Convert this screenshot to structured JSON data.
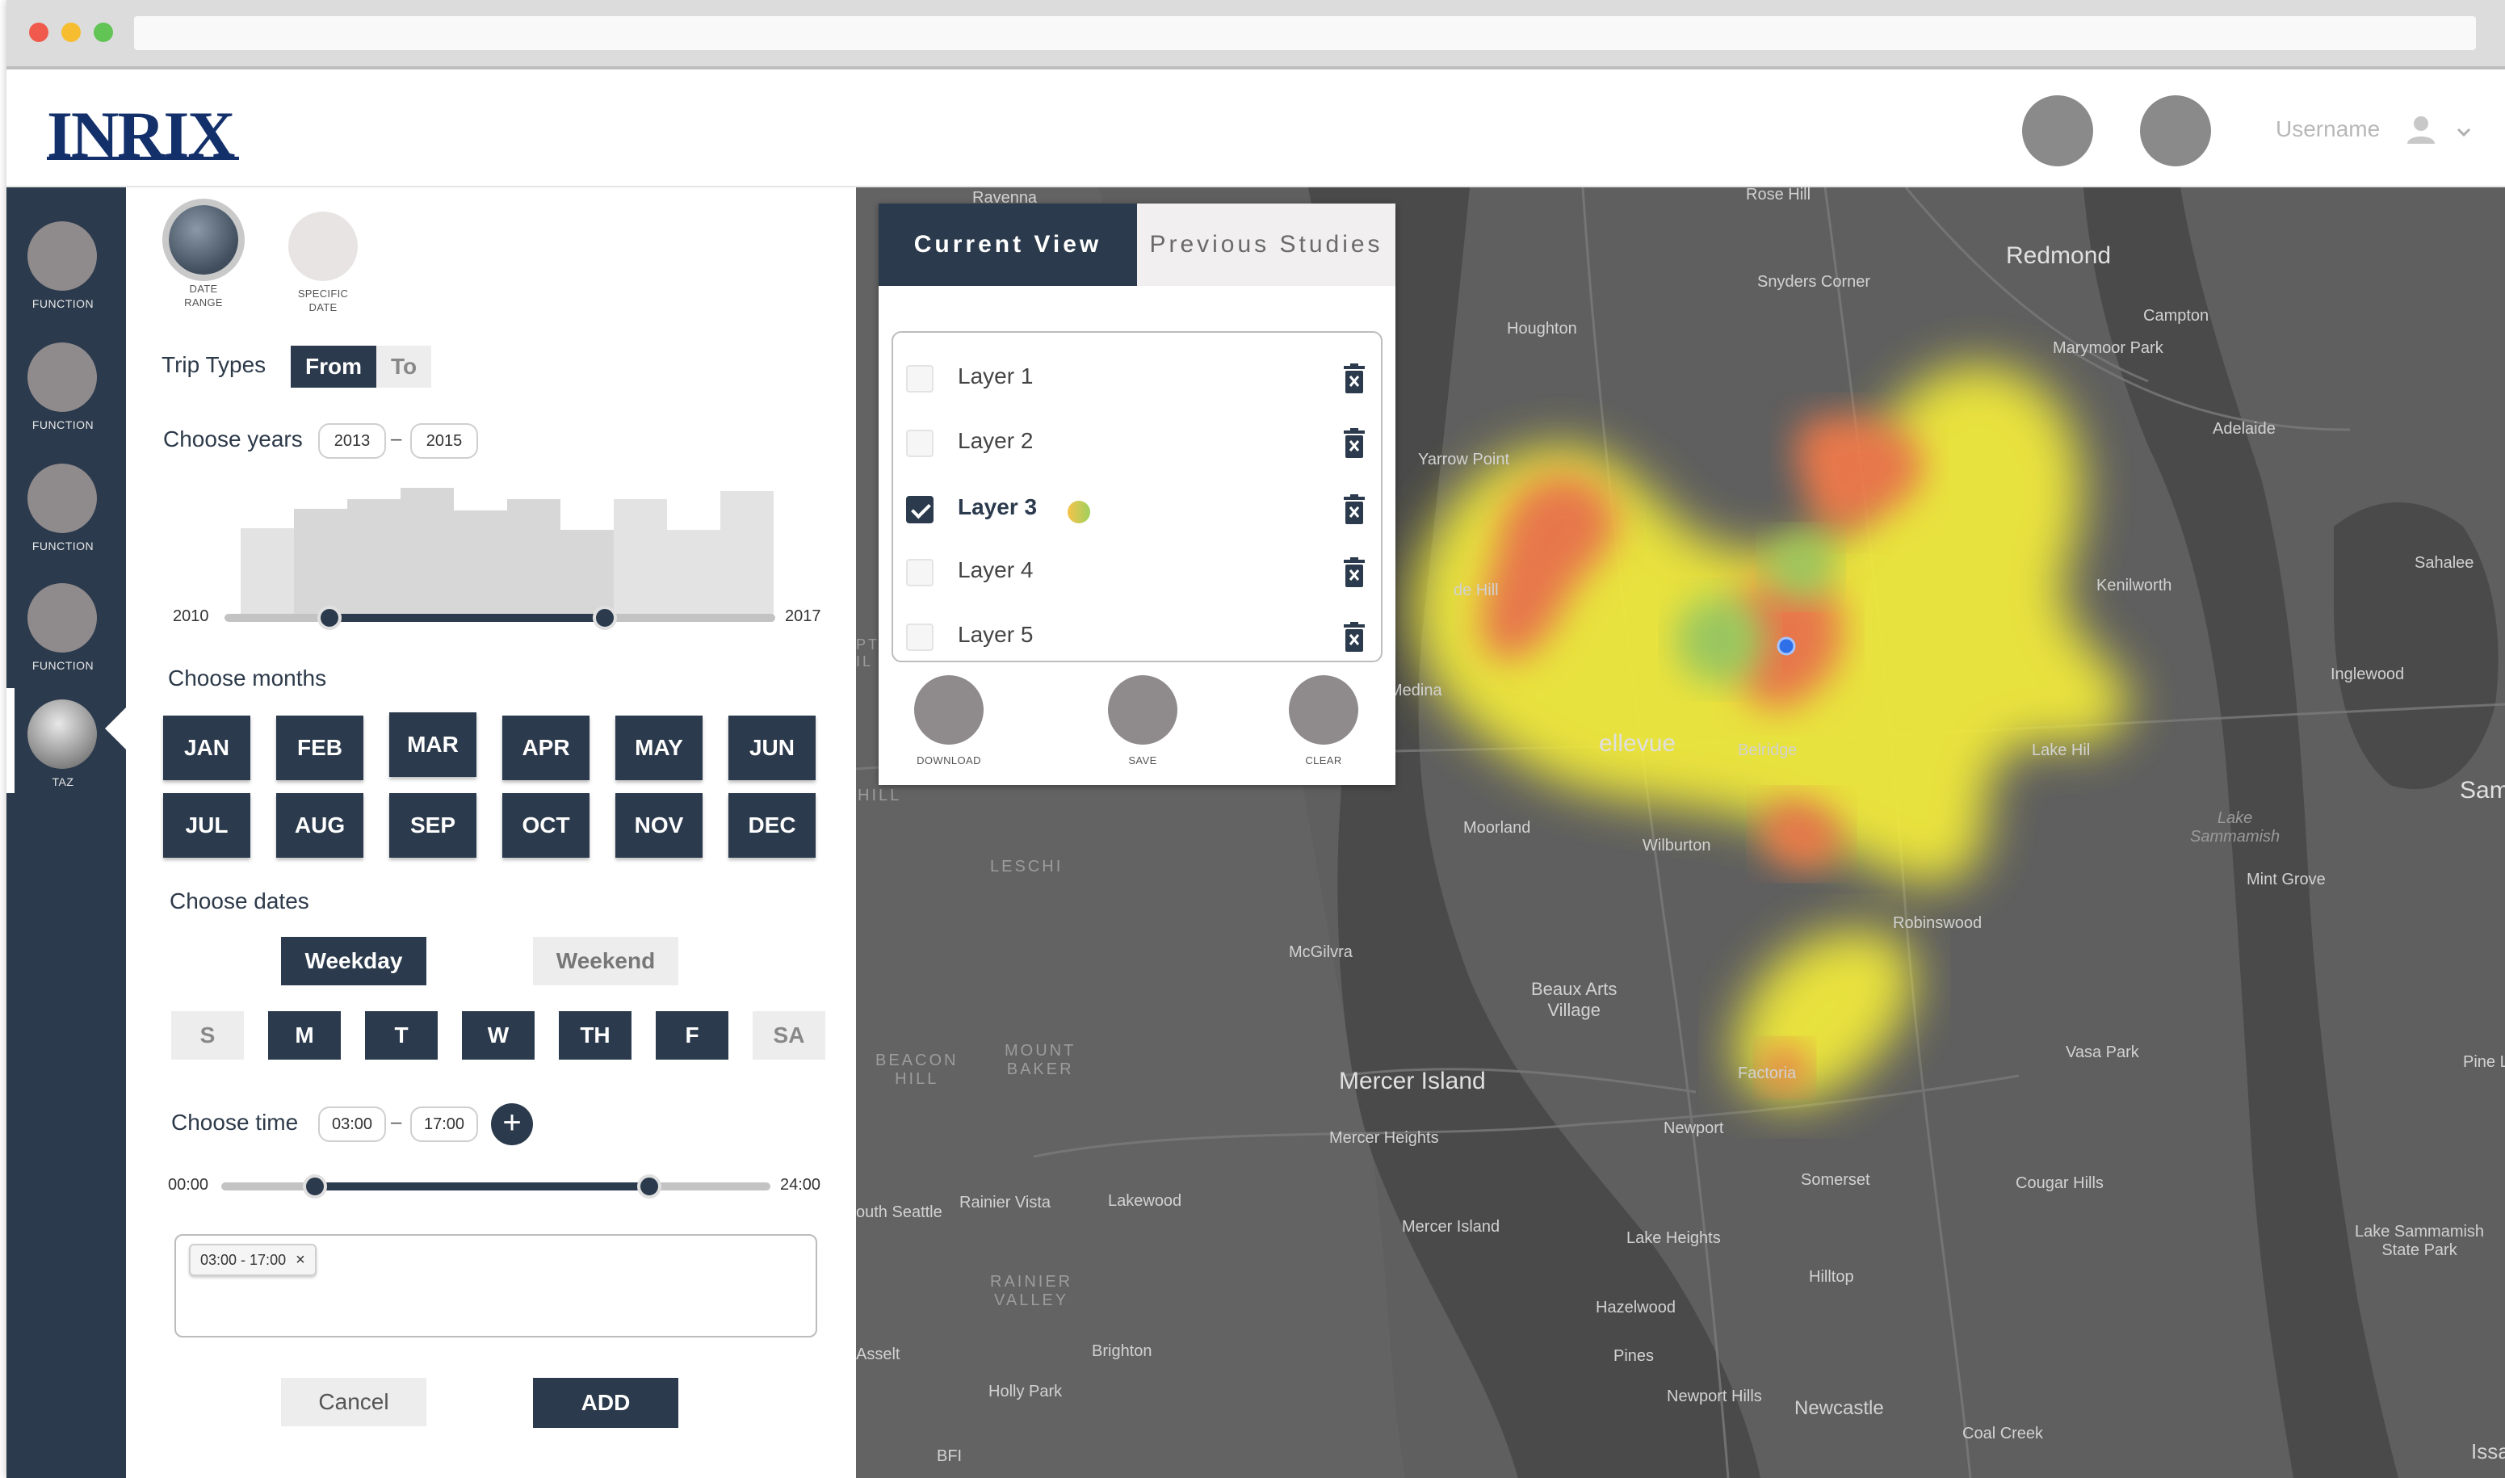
{
  "header": {
    "logo": "INRIX",
    "username": "Username"
  },
  "rail": {
    "items": [
      {
        "label": "FUNCTION"
      },
      {
        "label": "FUNCTION"
      },
      {
        "label": "FUNCTION"
      },
      {
        "label": "FUNCTION"
      },
      {
        "label": "TAZ"
      }
    ]
  },
  "panel": {
    "modes": {
      "date_range": "DATE\nRANGE",
      "specific_date": "SPECIFIC\nDATE"
    },
    "trip_types": {
      "label": "Trip Types",
      "from": "From",
      "to": "To",
      "selected": "From"
    },
    "years": {
      "label": "Choose years",
      "start": "2013",
      "end": "2015",
      "min_label": "2010",
      "max_label": "2017",
      "range_start_fraction": 0.19,
      "range_end_fraction": 0.69
    },
    "months": {
      "label": "Choose  months",
      "items": [
        "JAN",
        "FEB",
        "MAR",
        "APR",
        "MAY",
        "JUN",
        "JUL",
        "AUG",
        "SEP",
        "OCT",
        "NOV",
        "DEC"
      ]
    },
    "dates": {
      "label": "Choose dates",
      "weekday": "Weekday",
      "weekend": "Weekend",
      "days": [
        {
          "label": "S",
          "selected": false
        },
        {
          "label": "M",
          "selected": true
        },
        {
          "label": "T",
          "selected": true
        },
        {
          "label": "W",
          "selected": true
        },
        {
          "label": "TH",
          "selected": true
        },
        {
          "label": "F",
          "selected": true
        },
        {
          "label": "SA",
          "selected": false
        }
      ]
    },
    "time": {
      "label": "Choose time",
      "start": "03:00",
      "end": "17:00",
      "min_label": "00:00",
      "max_label": "24:00",
      "add": "+",
      "range_start_fraction": 0.17,
      "range_end_fraction": 0.78
    },
    "tags": [
      {
        "text": "03:00 - 17:00",
        "remove": "×"
      }
    ],
    "cancel": "Cancel",
    "add": "ADD"
  },
  "layers_panel": {
    "tabs": {
      "current": "Current View",
      "previous": "Previous Studies"
    },
    "layers": [
      {
        "name": "Layer 1",
        "checked": false
      },
      {
        "name": "Layer 2",
        "checked": false
      },
      {
        "name": "Layer 3",
        "checked": true
      },
      {
        "name": "Layer 4",
        "checked": false
      },
      {
        "name": "Layer 5",
        "checked": false
      }
    ],
    "actions": {
      "download": "DOWNLOAD",
      "save": "SAVE",
      "clear": "CLEAR"
    }
  },
  "map": {
    "places": {
      "ravenna": "Ravenna",
      "rose_hill": "Rose Hill",
      "redmond": "Redmond",
      "snyders_corner": "Snyders Corner",
      "campton": "Campton",
      "marymoor_park": "Marymoor Park",
      "houghton": "Houghton",
      "adelaide": "Adelaide",
      "yarrow_point": "Yarrow Point",
      "sahalee": "Sahalee",
      "kenilworth": "Kenilworth",
      "de_hill": "de Hill",
      "inglewood": "Inglewood",
      "medina": "Medina",
      "bellevue": "ellevue",
      "belridge": "Belridge",
      "lake_hills": "Lake Hil",
      "samm": "Samm",
      "moorland": "Moorland",
      "lake_sammamish_water": "Lake\nSammamish",
      "wilburton": "Wilburton",
      "mint_grove": "Mint Grove",
      "leschi": "LESCHI",
      "robinswood": "Robinswood",
      "mcgilvra": "McGilvra",
      "beaux_arts": "Beaux Arts\nVillage",
      "beacon_hill": "BEACON\nHILL",
      "mount_baker": "MOUNT\nBAKER",
      "vasa_park": "Vasa Park",
      "pine_l": "Pine L",
      "mercer_island": "Mercer Island",
      "factoria": "Factoria",
      "mercer_heights": "Mercer Heights",
      "newport": "Newport",
      "south_seattle": "outh Seattle",
      "rainier_vista": "Rainier Vista",
      "lakewood": "Lakewood",
      "somerset": "Somerset",
      "cougar_hills": "Cougar Hills",
      "mercer_island_2": "Mercer Island",
      "lake_heights": "Lake Heights",
      "lake_sammamish_sp": "Lake Sammamish\nState Park",
      "rainier_valley": "RAINIER\nVALLEY",
      "hilltop": "Hilltop",
      "hazelwood": "Hazelwood",
      "brighton": "Brighton",
      "assalt": "Asselt",
      "pines": "Pines",
      "holly_park": "Holly Park",
      "newport_hills": "Newport Hills",
      "newcastle": "Newcastle",
      "coal_creek": "Coal Creek",
      "issa": "Issa",
      "bfi": "BFI",
      "hill": "HILL",
      "pt": "PT\nIL"
    }
  }
}
